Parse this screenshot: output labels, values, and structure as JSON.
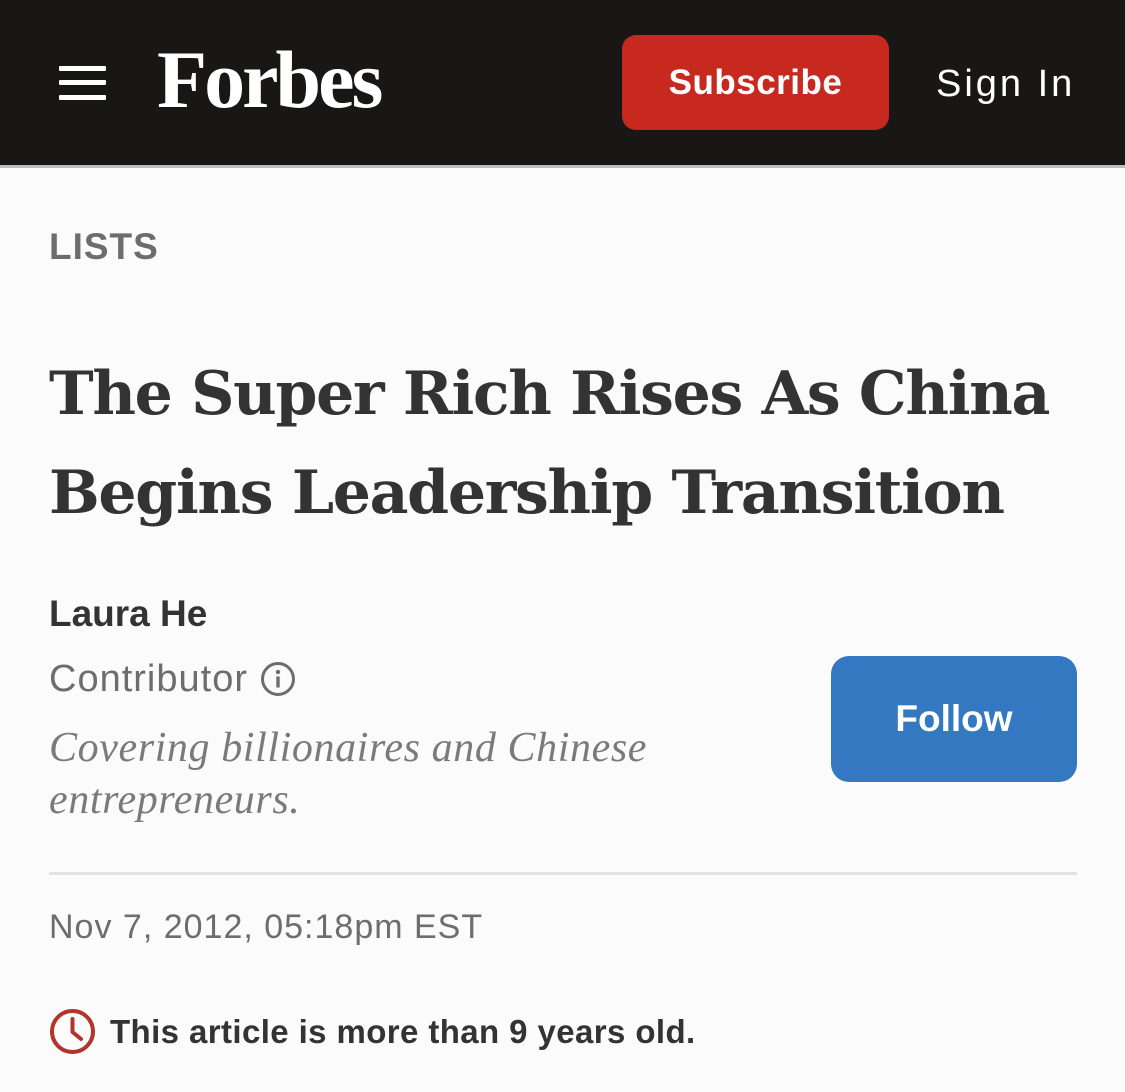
{
  "header": {
    "logo_text": "Forbes",
    "subscribe_label": "Subscribe",
    "signin_label": "Sign In",
    "menu_icon": "hamburger-menu-icon"
  },
  "article": {
    "category": "LISTS",
    "headline_line1": "The Super Rich Rises As China",
    "headline_line2": "Begins Leadership Transition",
    "author": {
      "name": "Laura He",
      "role": "Contributor",
      "bio_line1": "Covering billionaires and Chinese",
      "bio_line2": "entrepreneurs.",
      "follow_label": "Follow"
    },
    "timestamp": "Nov 7, 2012,  05:18pm EST",
    "age_notice": "This article is more than 9 years old."
  },
  "colors": {
    "header_bg": "#181716",
    "subscribe_bg": "#c7291f",
    "follow_bg": "#3478c1",
    "clock_icon": "#b0352b"
  }
}
